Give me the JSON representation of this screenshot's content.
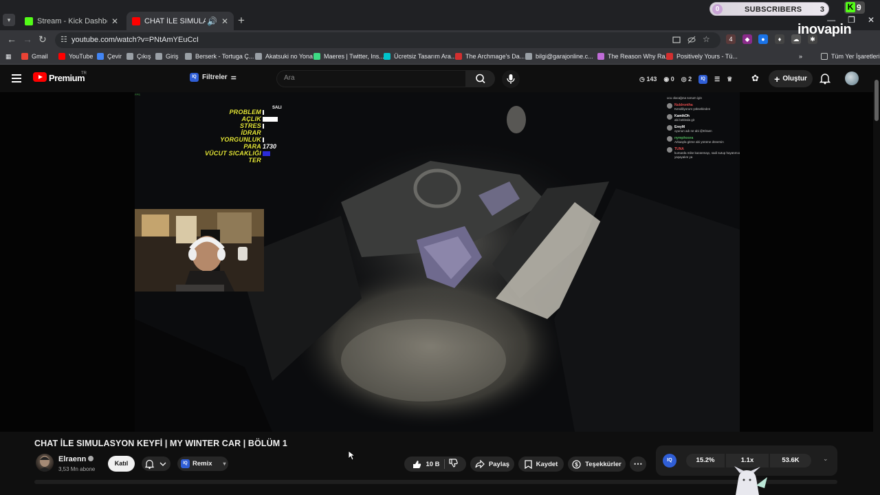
{
  "browser": {
    "tabs": [
      {
        "label": "Stream - Kick Dashboard",
        "favicon_color": "#53fc18"
      },
      {
        "label": "CHAT İLE SIMULASYON KEYİ",
        "favicon_color": "#ff0000"
      }
    ],
    "url": "youtube.com/watch?v=PNtAmYEuCcI",
    "bookmarks": [
      {
        "label": "Gmail",
        "color": "#ea4335"
      },
      {
        "label": "YouTube",
        "color": "#ff0000"
      },
      {
        "label": "Çevir",
        "color": "#4285f4"
      },
      {
        "label": "Çıkış",
        "color": "#9aa0a6"
      },
      {
        "label": "Giriş",
        "color": "#9aa0a6"
      },
      {
        "label": "Berserk - Tortuga Ç...",
        "color": "#9aa0a6"
      },
      {
        "label": "Akatsuki no Yona",
        "color": "#9aa0a6"
      },
      {
        "label": "Maeres | Twitter, Ins...",
        "color": "#3ddc84"
      },
      {
        "label": "Ücretsiz Tasarım Ara...",
        "color": "#00c4cc"
      },
      {
        "label": "The Archmage's Da...",
        "color": "#d32f2f"
      },
      {
        "label": "bilgi@garajonline.c...",
        "color": "#9aa0a6"
      },
      {
        "label": "The Reason Why Ra...",
        "color": "#c06cd8"
      },
      {
        "label": "Positively Yours - Tü...",
        "color": "#d32f2f"
      }
    ],
    "bookmarks_more": "»",
    "all_bookmarks": "Tüm Yer İşaretleri"
  },
  "overlay": {
    "subscriber_current": "0",
    "subscriber_label": "SUBSCRIBERS",
    "subscriber_goal": "3",
    "kick_count": "9",
    "kick_letter": "K",
    "watermark": "inovapin"
  },
  "youtube": {
    "brand": "Premium",
    "region": "TR",
    "filters_label": "Filtreler",
    "iq_badge": "IQ",
    "search_placeholder": "Ara",
    "header_stats": [
      "143",
      "0",
      "2"
    ],
    "create_label": "Oluştur"
  },
  "video": {
    "title": "CHAT İLE SIMULASYON KEYFİ | MY WINTER CAR | BÖLÜM 1",
    "channel": "Elraenn",
    "subscribers": "3,53 Mn abone",
    "join_label": "Katıl",
    "remix_label": "Remix",
    "likes": "10 B",
    "share_label": "Paylaş",
    "save_label": "Kaydet",
    "thanks_label": "Teşekkürler",
    "iq_stats": [
      "15.2%",
      "1.1x",
      "53.6K"
    ]
  },
  "game_hud": {
    "day": "SALI",
    "stats": [
      {
        "label": "PROBLEM",
        "level": 0.02,
        "text": ""
      },
      {
        "label": "AÇLIK",
        "level": 0.6,
        "text": ""
      },
      {
        "label": "STRES",
        "level": 0.05,
        "text": ""
      },
      {
        "label": "İDRAR",
        "level": 0,
        "text": ""
      },
      {
        "label": "YORGUNLUK",
        "level": 0.04,
        "text": ""
      },
      {
        "label": "PARA",
        "level": 0,
        "text": "1730"
      },
      {
        "label": "VÜCUT SICAKLIĞI",
        "level": 0.3,
        "text": ""
      },
      {
        "label": "TER",
        "level": 0,
        "text": ""
      }
    ],
    "chat": [
      {
        "user": "",
        "msg": "ucu olacağına sonum igin"
      },
      {
        "user": "Nuldrontha",
        "msg": "Kendiliyorum yüksekleden"
      },
      {
        "user": "KamikOh",
        "msg": "abi bekleda git"
      },
      {
        "user": "EreyM",
        "msg": "oyunun adı ne abi @Elraen"
      },
      {
        "user": "nymphoora",
        "msg": "Arkaayla gitme abi yürüme dönersin"
      },
      {
        "user": "TUNA",
        "msg": "kumarda mike kazanmayı, sadi sutup hayatımıo yaşayalım ya"
      }
    ],
    "chat_colors": [
      "#e04b4b",
      "#ffffff",
      "#ffffff",
      "#4fb35a",
      "#e04b4b"
    ]
  }
}
